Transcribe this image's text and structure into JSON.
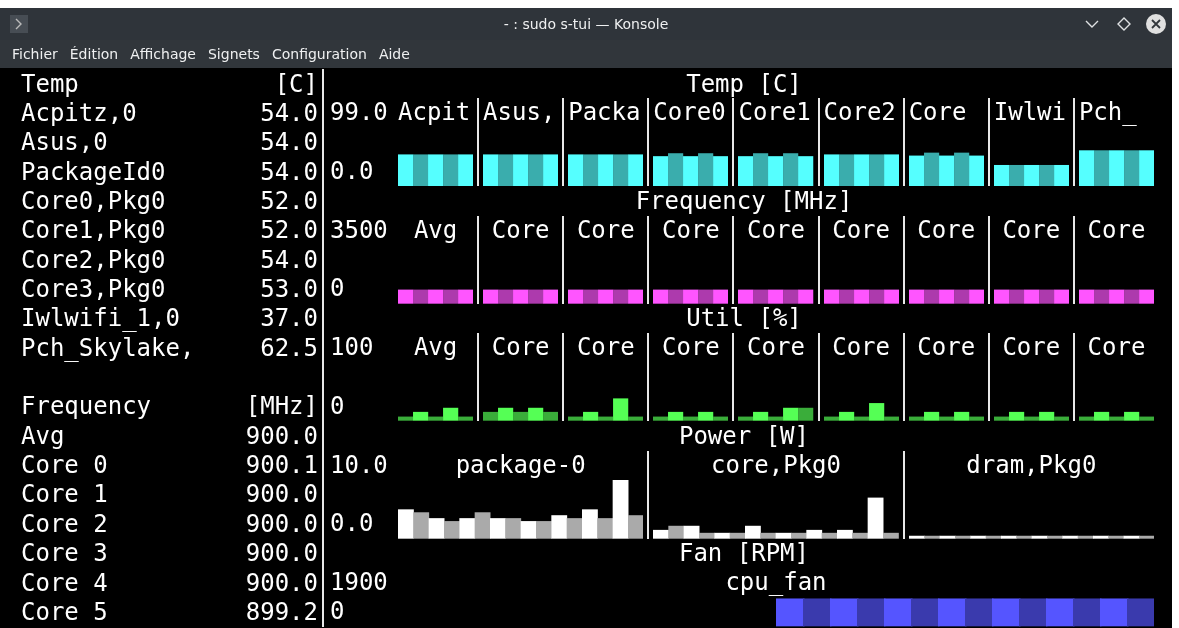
{
  "window": {
    "title": "- : sudo s-tui — Konsole"
  },
  "menu": [
    "Fichier",
    "Édition",
    "Affichage",
    "Signets",
    "Configuration",
    "Aide"
  ],
  "sensors": [
    {
      "title": "Temp",
      "unit": "[C]",
      "rows": [
        {
          "name": "Acpitz,0",
          "value": "54.0"
        },
        {
          "name": "Asus,0",
          "value": "54.0"
        },
        {
          "name": "PackageId0",
          "value": "54.0"
        },
        {
          "name": "Core0,Pkg0",
          "value": "52.0"
        },
        {
          "name": "Core1,Pkg0",
          "value": "52.0"
        },
        {
          "name": "Core2,Pkg0",
          "value": "54.0"
        },
        {
          "name": "Core3,Pkg0",
          "value": "53.0"
        },
        {
          "name": "Iwlwifi_1,0",
          "value": "37.0"
        },
        {
          "name": "Pch_Skylake,",
          "value": "62.5"
        }
      ]
    },
    {
      "title": "Frequency",
      "unit": "[MHz]",
      "rows": [
        {
          "name": "Avg",
          "value": "900.0"
        },
        {
          "name": "Core 0",
          "value": "900.1"
        },
        {
          "name": "Core 1",
          "value": "900.0"
        },
        {
          "name": "Core 2",
          "value": "900.0"
        },
        {
          "name": "Core 3",
          "value": "900.0"
        },
        {
          "name": "Core 4",
          "value": "900.0"
        },
        {
          "name": "Core 5",
          "value": "899.2"
        }
      ]
    }
  ],
  "graphs": [
    {
      "kind": "temp",
      "title": "Temp [C]",
      "scale_max": "99.0",
      "scale_min": "0.0",
      "color": "#55ffff",
      "columns": [
        "Acpit",
        "Asus,",
        "Packa",
        "Core0",
        "Core1",
        "Core2",
        "Core",
        "Iwlwi",
        "Pch_"
      ]
    },
    {
      "kind": "freq",
      "title": "Frequency [MHz]",
      "scale_max": "3500",
      "scale_min": "0",
      "color": "#ff55ff",
      "columns": [
        "Avg",
        "Core",
        "Core",
        "Core",
        "Core",
        "Core",
        "Core",
        "Core",
        "Core"
      ]
    },
    {
      "kind": "util",
      "title": "Util [%]",
      "scale_max": "100",
      "scale_min": "0",
      "color": "#55ff55",
      "columns": [
        "Avg",
        "Core",
        "Core",
        "Core",
        "Core",
        "Core",
        "Core",
        "Core",
        "Core"
      ]
    },
    {
      "kind": "power",
      "title": "Power [W]",
      "scale_max": "10.0",
      "scale_min": "0.0",
      "color": "#ffffff",
      "columns": [
        "package-0",
        "core,Pkg0",
        "dram,Pkg0"
      ]
    },
    {
      "kind": "fan",
      "title": "Fan [RPM]",
      "scale_max": "1900",
      "scale_min": "0",
      "color": "#5555ff",
      "columns": [
        "cpu_fan"
      ]
    }
  ]
}
